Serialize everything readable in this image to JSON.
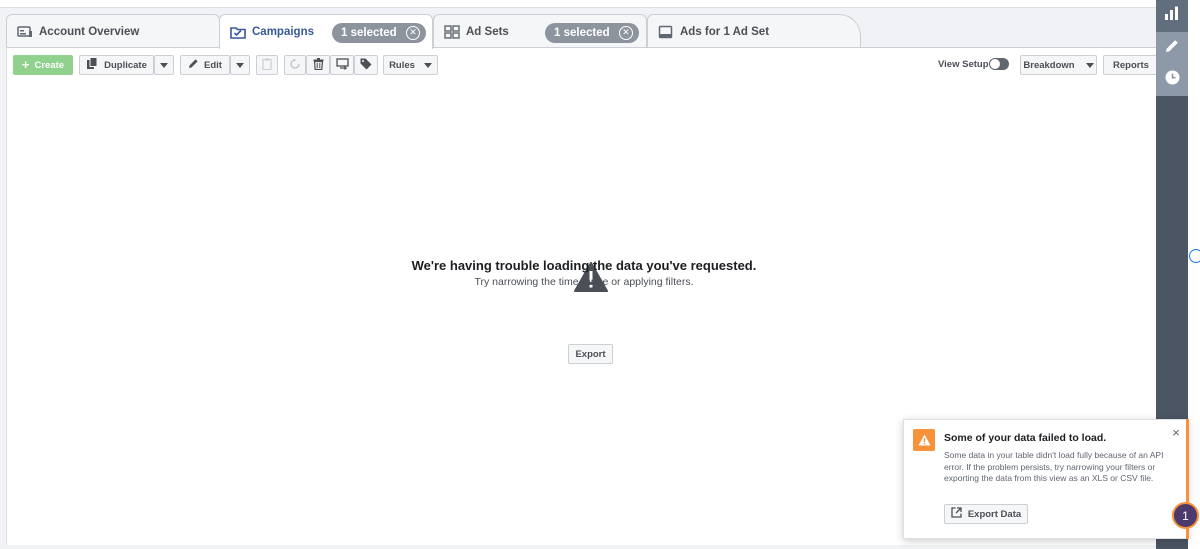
{
  "tabs": {
    "account_overview": "Account Overview",
    "campaigns": "Campaigns",
    "campaigns_selected": "1 selected",
    "ad_sets": "Ad Sets",
    "ad_sets_selected": "1 selected",
    "ads": "Ads for 1 Ad Set"
  },
  "toolbar": {
    "create": "Create",
    "duplicate": "Duplicate",
    "edit": "Edit",
    "rules": "Rules",
    "view_setup": "View Setup",
    "breakdown": "Breakdown",
    "reports": "Reports"
  },
  "empty_state": {
    "title": "We're having trouble loading the data you've requested.",
    "subtitle": "Try narrowing the time range or applying filters.",
    "export": "Export"
  },
  "toast": {
    "title": "Some of your data failed to load.",
    "body": "Some data in your table didn't load fully because of an API error. If the problem persists, try narrowing your filters or exporting the data from this view as an XLS or CSV file.",
    "export_label": "Export Data",
    "close": "×"
  },
  "notification_count": "1",
  "colors": {
    "accent_blue": "#385898",
    "create_green": "#8fd18d",
    "warning_orange": "#f7923b",
    "rail": "#4b5563"
  }
}
